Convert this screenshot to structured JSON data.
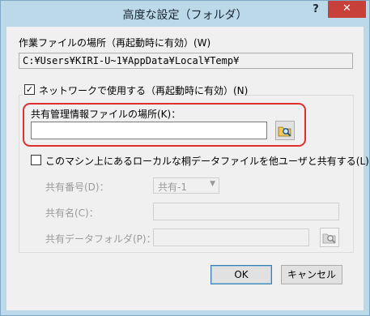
{
  "window": {
    "title": "高度な設定（フォルダ）",
    "help_label": "?",
    "close_label": "✕"
  },
  "work_folder": {
    "label": "作業ファイルの場所（再起動時に有効）(W)",
    "value": "C:¥Users¥KIRI-U~1¥AppData¥Local¥Temp¥"
  },
  "network": {
    "checkbox_label": "ネットワークで使用する（再起動時に有効）(N)",
    "checked": true,
    "shared_info_label": "共有管理情報ファイルの場所(K)：",
    "shared_info_value": "",
    "share_checkbox_label": "このマシン上にあるローカルな桐データファイルを他ユーザと共有する(L)",
    "share_checked": false,
    "share_number_label": "共有番号(D)：",
    "share_number_value": "共有-1",
    "share_name_label": "共有名(C)：",
    "share_name_value": "",
    "share_folder_label": "共有データフォルダ(P)：",
    "share_folder_value": ""
  },
  "buttons": {
    "ok": "OK",
    "cancel": "キャンセル"
  },
  "colors": {
    "titlebar": "#bcd9e9",
    "close": "#c7403a",
    "highlight": "#e03030"
  },
  "icons": {
    "browse": "folder-search-icon",
    "dropdown": "chevron-down-icon",
    "check": "checkmark-icon"
  }
}
